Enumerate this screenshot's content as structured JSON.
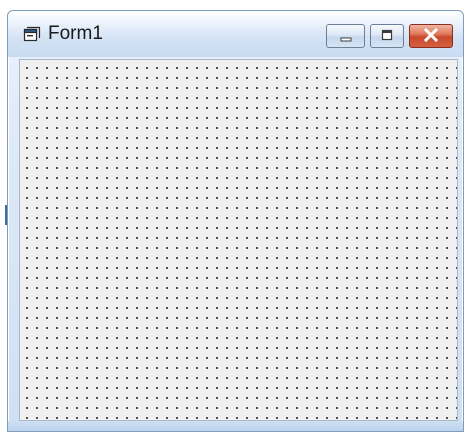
{
  "window": {
    "title": "Form1"
  },
  "icons": {
    "form": "form-icon",
    "minimize": "minimize-icon",
    "maximize": "maximize-icon",
    "close": "close-icon"
  },
  "colors": {
    "close_button": "#d4603f",
    "form_background": "#f0f0f0",
    "grid_dot": "#222222"
  }
}
